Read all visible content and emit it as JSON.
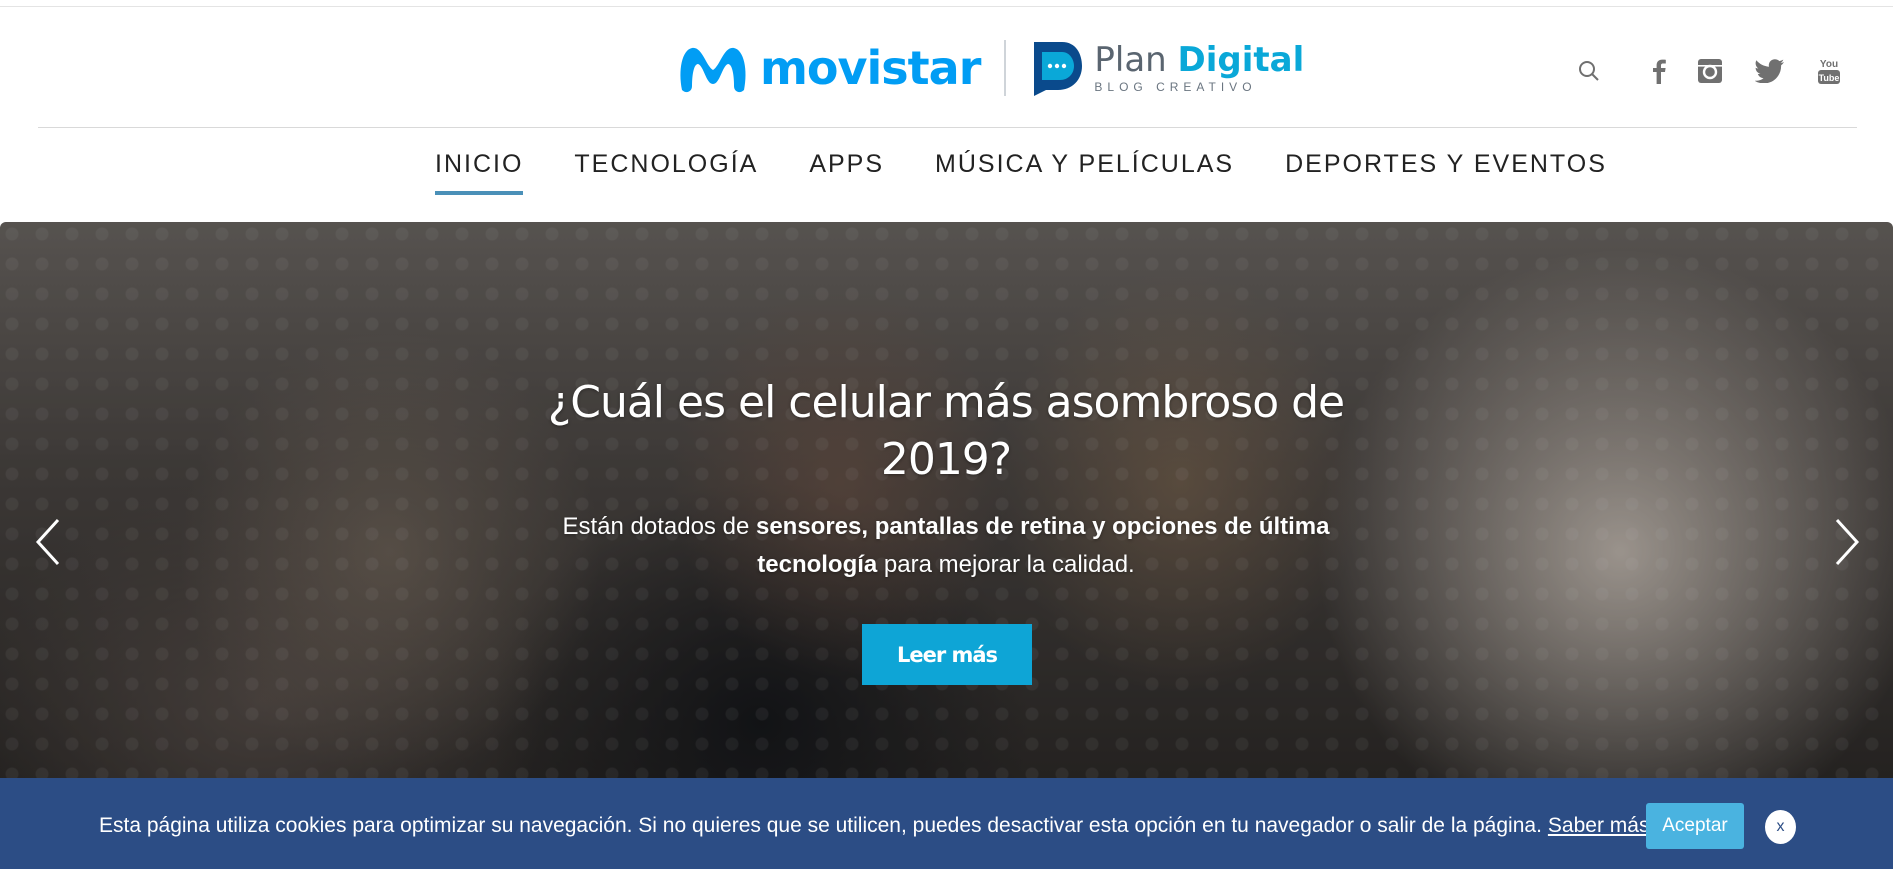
{
  "header": {
    "brand_name": "movistar",
    "blog_title_plain": "Plan ",
    "blog_title_bold": "Digital",
    "blog_subtitle": "BLOG CREATIVO",
    "social": [
      "search-icon",
      "facebook-icon",
      "instagram-icon",
      "twitter-icon",
      "youtube-icon"
    ],
    "youtube_label": "You Tube"
  },
  "nav": {
    "items": [
      {
        "label": "INICIO",
        "active": true
      },
      {
        "label": "TECNOLOGÍA",
        "active": false
      },
      {
        "label": "APPS",
        "active": false
      },
      {
        "label": "MÚSICA Y PELÍCULAS",
        "active": false
      },
      {
        "label": "DEPORTES Y EVENTOS",
        "active": false
      }
    ]
  },
  "hero": {
    "title": "¿Cuál es el celular más asombroso de 2019?",
    "desc_part1": "Están dotados de ",
    "desc_bold": "sensores, pantallas de retina y opciones de última tecnología",
    "desc_part2": " para mejorar la calidad.",
    "button_label": "Leer más"
  },
  "cookie": {
    "text": "Esta página utiliza cookies para optimizar su navegación. Si no quieres que se utilicen, puedes desactivar esta opción en tu navegador o salir de la página.",
    "link_label": "Saber más",
    "accept_label": "Aceptar",
    "close_label": "x"
  },
  "colors": {
    "brand": "#019df4",
    "accent": "#0ea5d6",
    "nav_underline": "#4a90b8",
    "cookie_bar": "#2c4d85",
    "icon_gray": "#707070"
  }
}
